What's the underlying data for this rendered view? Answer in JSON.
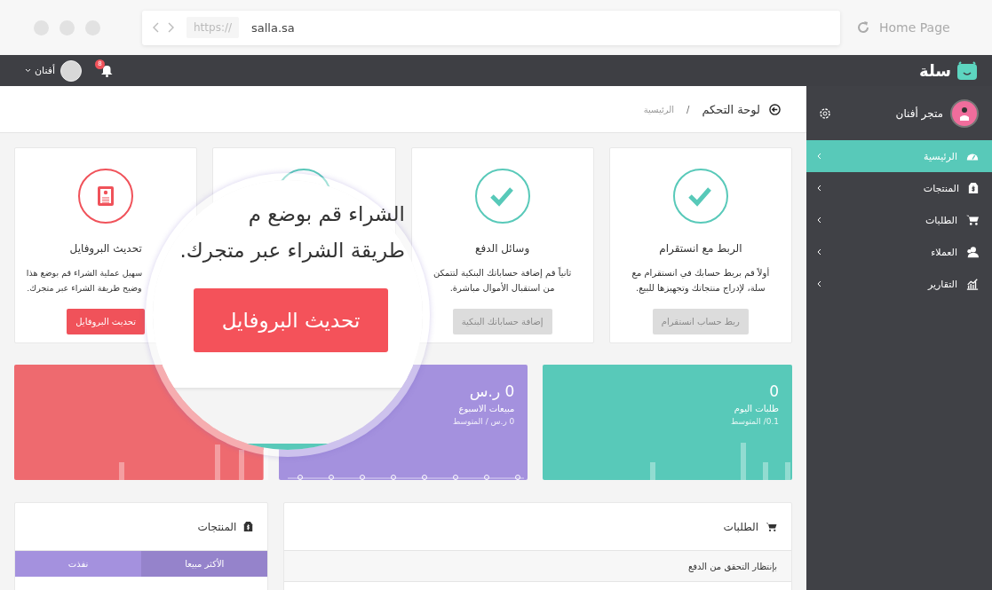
{
  "browser": {
    "url_scheme": "https://",
    "url": "salla.sa",
    "home_label": "Home Page"
  },
  "topbar": {
    "logo": "سلة",
    "notification_count": "8",
    "user_name": "أفنان"
  },
  "sidebar": {
    "store_name": "متجر أفنان",
    "items": [
      {
        "label": "الرئيسية",
        "kind": "dashboard",
        "selected": true
      },
      {
        "label": "المنتجات",
        "kind": "tag",
        "selected": false
      },
      {
        "label": "الطلبات",
        "kind": "cart",
        "selected": false
      },
      {
        "label": "العملاء",
        "kind": "users",
        "selected": false
      },
      {
        "label": "التقارير",
        "kind": "chart",
        "selected": false
      }
    ]
  },
  "breadcrumb": {
    "title": "لوحة التحكم",
    "separator": "/",
    "current": "الرئيسية"
  },
  "cards": [
    {
      "kind": "check",
      "title": "الربط مع انستقرام",
      "description": "أولاً قم بربط حسابك في انستقرام مع سلة، لإدراج منتجاتك وتجهيزها للبيع.",
      "button": {
        "label": "ربط حساب انستقرام",
        "disabled": true
      }
    },
    {
      "kind": "check",
      "title": "وسائل الدفع",
      "description": "ثانياً قم إضافة حساباتك البنكية لتتمكن من استقبال الأموال مباشرة.",
      "button": {
        "label": "إضافة حساباتك البنكية",
        "disabled": true
      }
    },
    {
      "kind": "covered"
    },
    {
      "kind": "profile",
      "title": "تحديث البروفايل",
      "description": "سهيل عملية الشراء قم بوضع هذا وضيح طريقة الشراء عبر متجرك.",
      "button": {
        "label": "تحديث البروفايل",
        "disabled": false
      }
    }
  ],
  "stats": [
    {
      "kind": "bars",
      "color": "#58c9b9",
      "value": "0",
      "label": "طلبات اليوم",
      "average": "0.1/ المتوسط"
    },
    {
      "kind": "line",
      "color": "#a491de",
      "value": "0 ر.س",
      "label": "مبيعات الاسبوع",
      "average": "0 ر.س / المتوسط"
    },
    {
      "kind": "bars",
      "color": "#ee6a6f"
    }
  ],
  "magnifier": {
    "lines": [
      "الشراء قم بوضع م",
      "طريقة الشراء عبر متجرك."
    ],
    "button": "تحديث البروفايل"
  },
  "orders_panel": {
    "title": "الطلبات",
    "rows": [
      "بإنتظار التحقق من الدفع"
    ]
  },
  "products_panel": {
    "title": "المنتجات",
    "tabs": [
      {
        "label": "الأكثر مبيعا",
        "selected": true
      },
      {
        "label": "نفذت",
        "selected": false
      }
    ]
  }
}
